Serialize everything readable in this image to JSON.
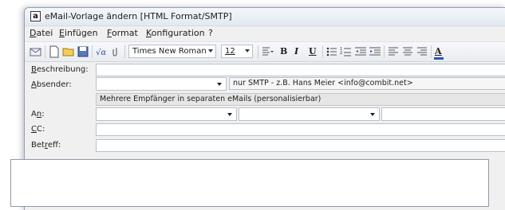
{
  "window": {
    "title": "eMail-Vorlage ändern  [HTML Format/SMTP]",
    "app_icon_letter": "a"
  },
  "menu": [
    {
      "key": "D",
      "rest": "atei"
    },
    {
      "key": "E",
      "rest": "infügen"
    },
    {
      "key": "F",
      "rest": "ormat"
    },
    {
      "key": "K",
      "rest": "onfiguration"
    },
    {
      "key": "",
      "rest": "?"
    }
  ],
  "toolbar": {
    "font_name": "Times New Roman",
    "font_size": "12",
    "bold": "B",
    "italic": "I",
    "underline": "U",
    "text_color": "A",
    "icons": [
      "email-icon",
      "new-document-icon",
      "open-folder-icon",
      "save-icon",
      "formula-icon",
      "attachment-icon",
      "paragraph-icon",
      "bullet-list-icon",
      "numbered-list-icon",
      "decrease-indent-icon",
      "increase-indent-icon",
      "align-left-icon",
      "align-center-icon",
      "align-right-icon",
      "font-color-icon"
    ]
  },
  "form": {
    "description_label_key": "B",
    "description_label_rest": "eschreibung:",
    "description_value": "",
    "sender_label_key": "A",
    "sender_label_rest": "bsender:",
    "sender_value": "",
    "sender_hint": "nur SMTP - z.B. Hans Meier <info@combit.net>",
    "separate_mails_label": "Mehrere Empfänger in separaten eMails (personalisierbar)",
    "to_label_pre": "A",
    "to_label_key": "n",
    "to_label_rest": ":",
    "cc_label_key": "C",
    "cc_label_rest": "C:",
    "subject_label_pre": "Bet",
    "subject_label_key": "r",
    "subject_label_rest": "eff:",
    "subject_value": ""
  }
}
